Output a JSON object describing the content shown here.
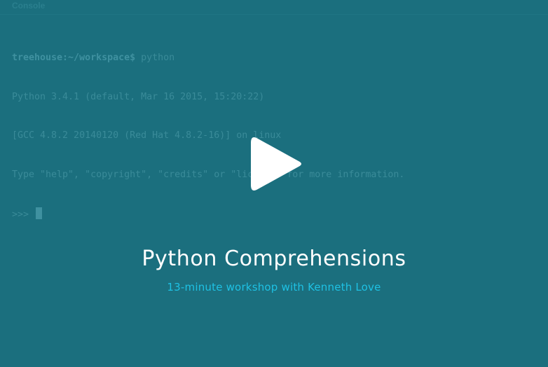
{
  "console": {
    "tab_label": "Console",
    "lines": [
      {
        "host": "treehouse:~/workspace$",
        "command": " python"
      },
      {
        "text": "Python 3.4.1 (default, Mar 16 2015, 15:20:22)"
      },
      {
        "text": "[GCC 4.8.2 20140120 (Red Hat 4.8.2-16)] on linux"
      },
      {
        "text": "Type \"help\", \"copyright\", \"credits\" or \"license\" for more information."
      },
      {
        "text": ">>> "
      }
    ]
  },
  "video": {
    "title": "Python Comprehensions",
    "subtitle": "13-minute workshop with Kenneth Love",
    "play_icon": "play-icon"
  },
  "colors": {
    "background": "#186a79",
    "title": "#ffffff",
    "subtitle": "#1ec1e4"
  }
}
